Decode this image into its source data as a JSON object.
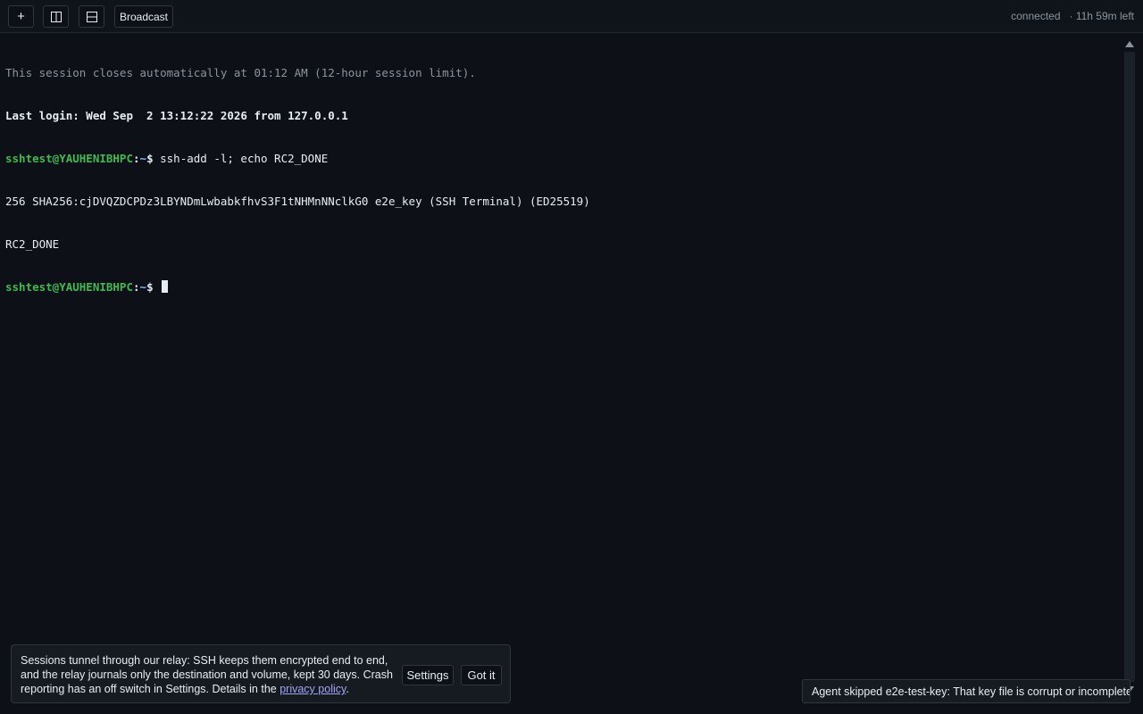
{
  "toolbar": {
    "new_label": "+",
    "split_vertical_icon": "split-vertical-icon",
    "split_horizontal_icon": "split-horizontal-icon",
    "broadcast_label": "Broadcast",
    "status": "connected",
    "time_left": "· 11h 59m left"
  },
  "terminal": {
    "notice": "This session closes automatically at 01:12 AM (12-hour session limit).",
    "last_login": "Last login: Wed Sep  2 13:12:22 2026 from 127.0.0.1",
    "prompt_user": "sshtest@YAUHENIBHPC",
    "prompt_sep": ":",
    "prompt_path": "~",
    "prompt_dollar": "$",
    "command_1": " ssh-add -l; echo RC2_DONE",
    "output_1": "256 SHA256:cjDVQZDCPDz3LBYNDmLwbabkfhvS3F1tNHMnNNclkG0 e2e_key (SSH Terminal) (ED25519)",
    "output_2": "RC2_DONE",
    "prompt2_trailing": " "
  },
  "banner": {
    "text_main": "Sessions tunnel through our relay: SSH keeps them encrypted end to end, and the relay journals only the destination and volume, kept 30 days. Crash reporting has an off switch in Settings. Details in the ",
    "link": "privacy policy",
    "text_end": ".",
    "settings_label": "Settings",
    "got_it_label": "Got it"
  },
  "toast": {
    "message": "Agent skipped e2e-test-key: That key file is corrupt or incomplete."
  },
  "colors": {
    "background": "#0d1117",
    "prompt_user": "#3fb950",
    "prompt_path": "#79c0ff",
    "link": "#a5a4f6"
  }
}
